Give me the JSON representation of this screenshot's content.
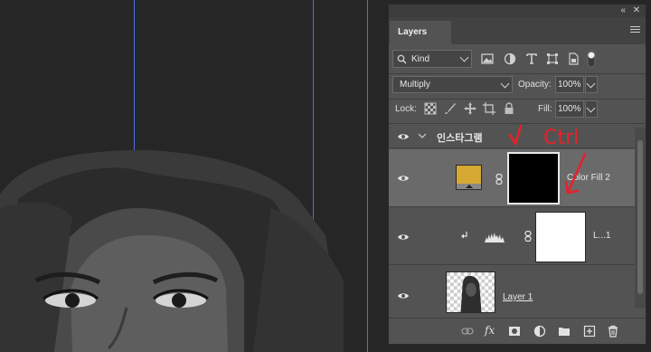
{
  "panel": {
    "tab_label": "Layers",
    "collapse_glyph": "«",
    "close_glyph": "✕",
    "filter": {
      "value": "Kind"
    },
    "blend_mode": {
      "value": "Multiply"
    },
    "opacity": {
      "label": "Opacity:",
      "value": "100%"
    },
    "lock": {
      "label": "Lock:"
    },
    "fill": {
      "label": "Fill:",
      "value": "100%"
    },
    "group": {
      "name": "인스타그램",
      "expanded": true
    },
    "layers": [
      {
        "name": "Color Fill 2",
        "kind": "color-fill",
        "swatch_color": "#d6a935",
        "mask_color": "#000000",
        "selected": true
      },
      {
        "name": "L...1",
        "kind": "levels-adjustment",
        "mask_color": "#ffffff",
        "clipped": true
      },
      {
        "name": "Layer 1",
        "kind": "pixel-layer"
      }
    ],
    "footer_icons": [
      "link-layers-icon",
      "fx-icon",
      "add-mask-icon",
      "adjustment-layer-icon",
      "new-group-icon",
      "new-layer-icon",
      "trash-icon"
    ],
    "fx_label": "fx"
  },
  "annotation": {
    "text": "Ctrl",
    "color": "#e8202a"
  },
  "colors": {
    "guide": "#4f6cf0",
    "panel_bg": "#535353",
    "selected_row": "#6a6a6a"
  }
}
